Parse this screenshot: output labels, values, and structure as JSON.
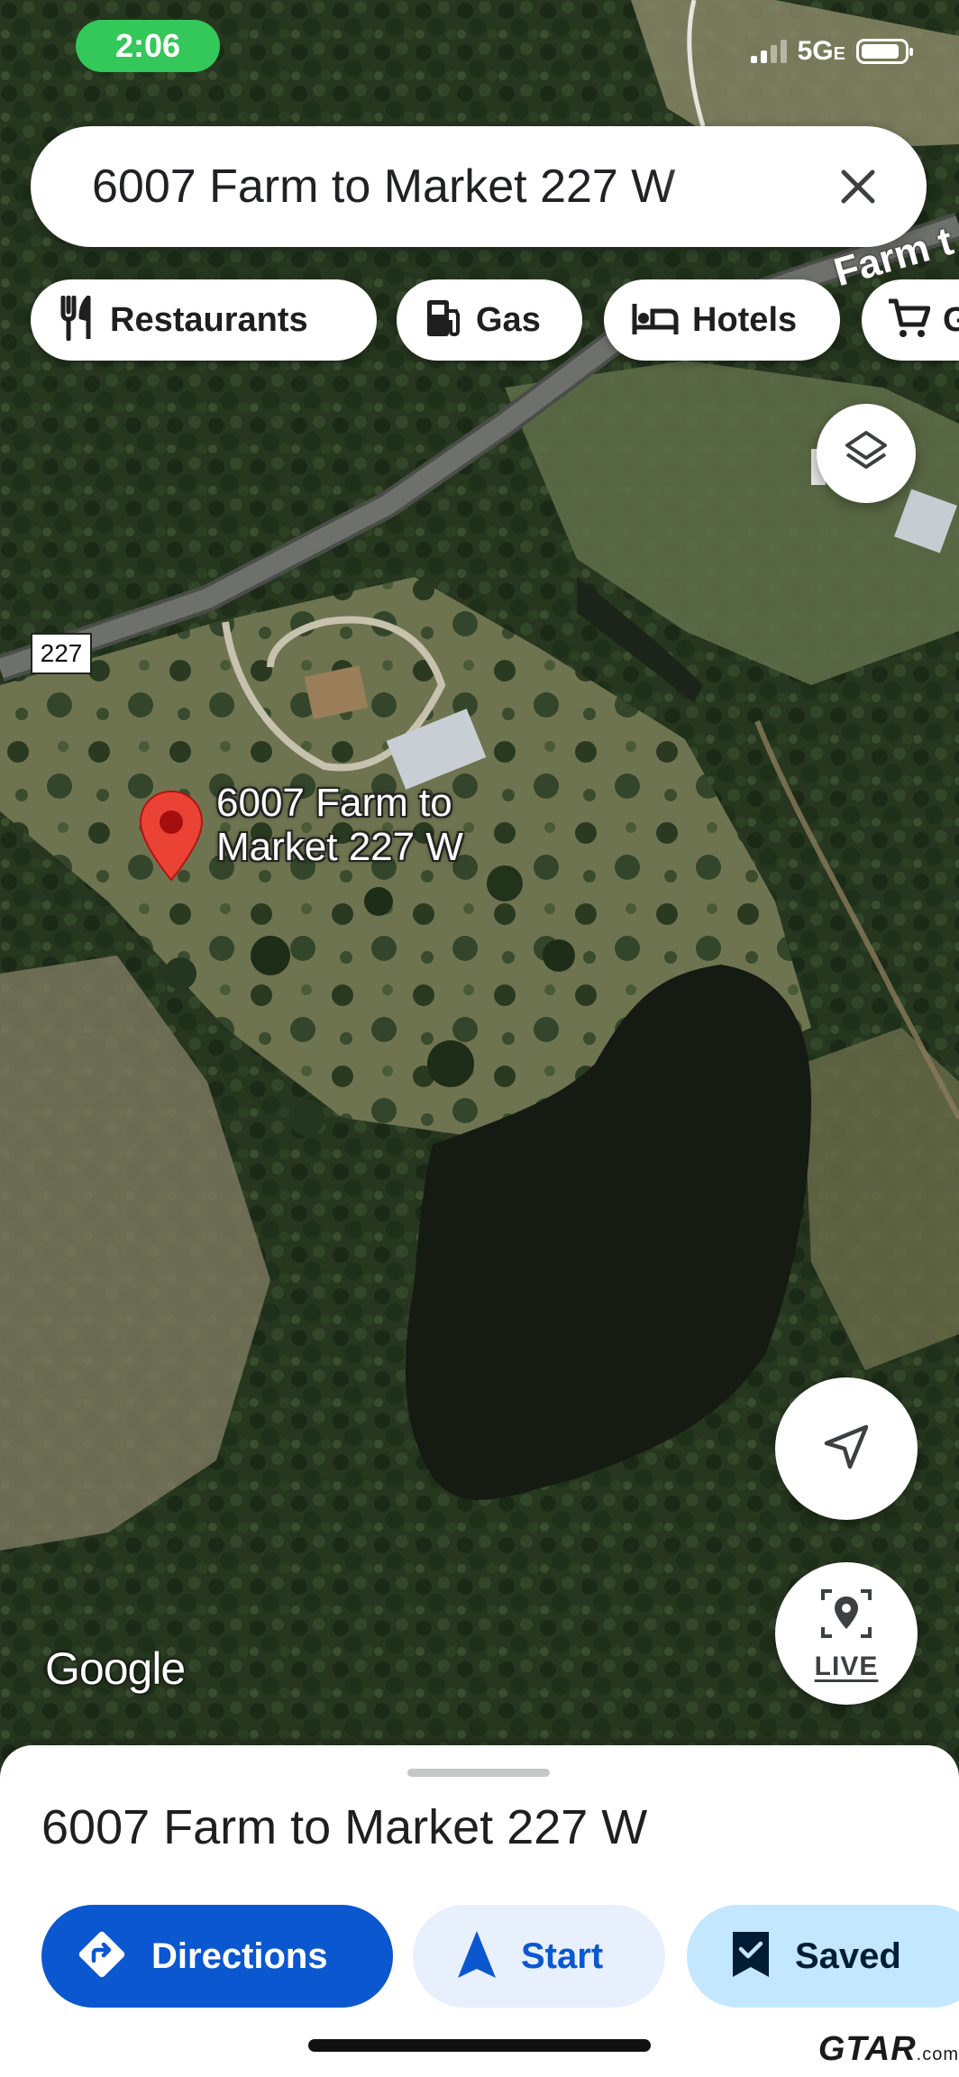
{
  "status_bar": {
    "time": "2:06",
    "network": "5G",
    "network_suffix": "E",
    "battery_level": 0.9,
    "icons": [
      "signal-icon",
      "battery-icon"
    ]
  },
  "search": {
    "query": "6007 Farm to Market 227 W",
    "clear_icon": "close-icon"
  },
  "chips": [
    {
      "label": "Restaurants",
      "icon": "restaurant-icon"
    },
    {
      "label": "Gas",
      "icon": "gas-station-icon"
    },
    {
      "label": "Hotels",
      "icon": "hotel-icon"
    },
    {
      "label": "G",
      "icon": "shopping-cart-icon"
    }
  ],
  "map": {
    "road_shield": "227",
    "road_name": "Farm t",
    "place_label": "6007 Farm to Market 227 W",
    "attribution": "Google",
    "layers_icon": "layers-icon",
    "location_icon": "my-location-arrow-icon",
    "live_label": "LIVE",
    "colors": {
      "pin": "#ea4335",
      "accent": "#0b57d0"
    }
  },
  "sheet": {
    "title": "6007 Farm to Market 227 W",
    "actions": {
      "directions": "Directions",
      "start": "Start",
      "saved": "Saved"
    }
  },
  "watermark": {
    "brand": "GTAR",
    "suffix": ".com"
  }
}
